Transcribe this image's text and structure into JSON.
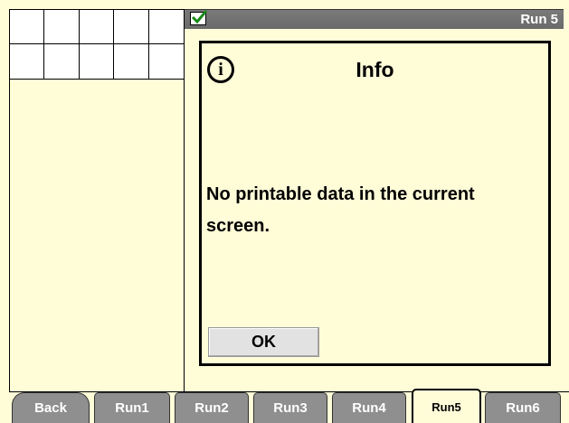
{
  "title_bar": {
    "run_title": "Run 5",
    "status_icon": "checkmark-icon"
  },
  "dialog": {
    "icon": "info-icon",
    "icon_glyph": "i",
    "title": "Info",
    "message": "No printable data in the current screen.",
    "ok_label": "OK"
  },
  "tabs": [
    {
      "label": "Back"
    },
    {
      "label": "Run1"
    },
    {
      "label": "Run2"
    },
    {
      "label": "Run3"
    },
    {
      "label": "Run4"
    },
    {
      "label": "Run5",
      "active": true
    },
    {
      "label": "Run6"
    }
  ],
  "colors": {
    "background": "#fffcd8",
    "tab_inactive": "#8f8f8f",
    "title_bar": "#737373"
  }
}
